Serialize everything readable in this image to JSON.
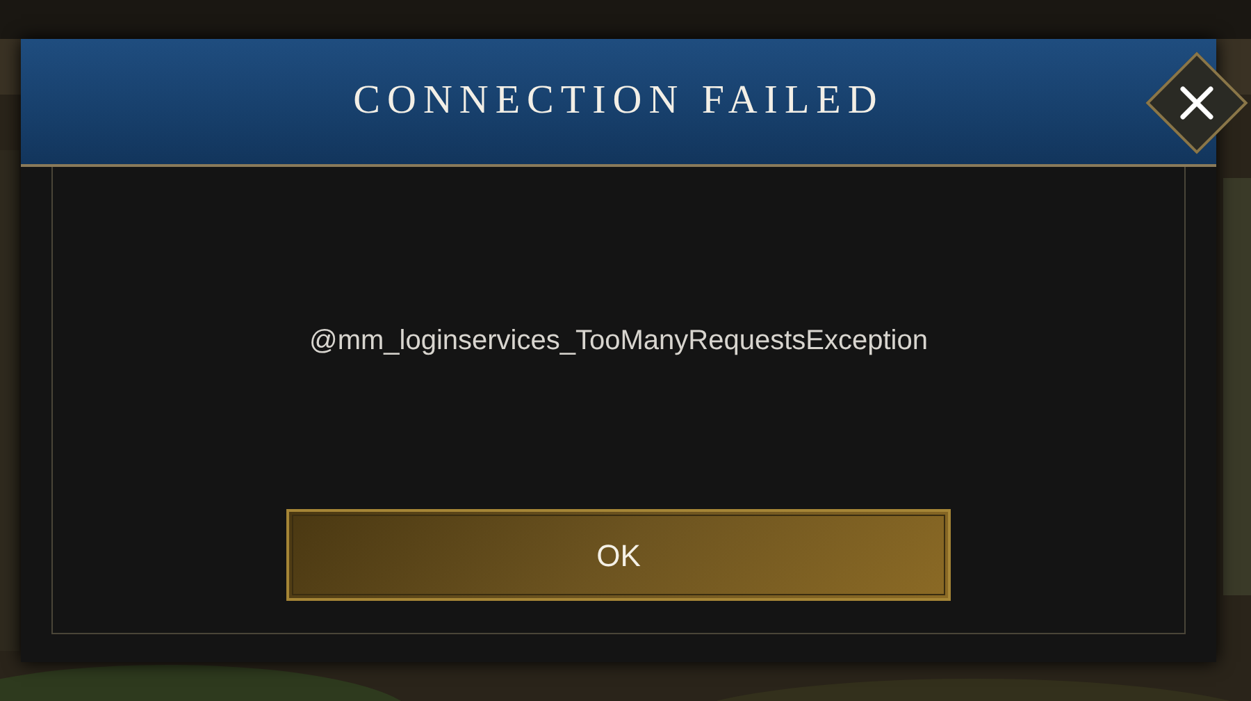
{
  "dialog": {
    "title": "CONNECTION FAILED",
    "message": "@mm_loginservices_TooManyRequestsException",
    "buttons": [
      {
        "label": "OK"
      }
    ]
  }
}
